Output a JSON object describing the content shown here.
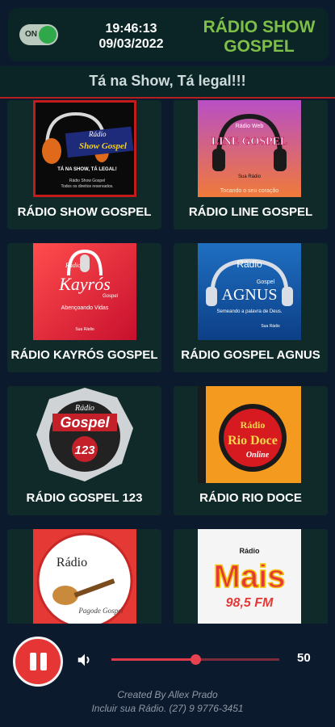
{
  "header": {
    "toggle_label": "ON",
    "time": "19:46:13",
    "date": "09/03/2022",
    "title_line1": "RÁDIO SHOW",
    "title_line2": "GOSPEL"
  },
  "slogan": "Tá na Show, Tá legal!!!",
  "stations": [
    {
      "name": "RÁDIO SHOW GOSPEL",
      "logo_text": [
        "Rádio",
        "Show Gospel",
        "TÁ NA SHOW, TÁ LEGAL!",
        "Rádio Show Gospel",
        "Todos os direitos reservados."
      ]
    },
    {
      "name": "RÁDIO LINE GOSPEL",
      "logo_text": [
        "Rádio Web",
        "LINE GOSPEL",
        "Sua Rádio",
        "Tocando o seu coração"
      ]
    },
    {
      "name": "RÁDIO KAYRÓS GOSPEL",
      "logo_text": [
        "Rádio",
        "Kayrós",
        "Gospel",
        "Abençoando Vidas",
        "Sua Rádio"
      ]
    },
    {
      "name": "RÁDIO GOSPEL AGNUS",
      "logo_text": [
        "Rádio",
        "Gospel",
        "AGNUS",
        "Semeando a palavra de Deus.",
        "Sua Rádio"
      ]
    },
    {
      "name": "RÁDIO GOSPEL 123",
      "logo_text": [
        "Rádio",
        "Gospel",
        "123"
      ]
    },
    {
      "name": "RÁDIO RIO DOCE",
      "logo_text": [
        "Rádio",
        "Rio Doce",
        "Online"
      ]
    },
    {
      "name": "",
      "logo_text": [
        "Rádio",
        "Pagode Gospel"
      ]
    },
    {
      "name": "",
      "logo_text": [
        "Rádio",
        "Mais",
        "98,5 FM"
      ]
    }
  ],
  "player": {
    "volume": 50,
    "volume_label": "50"
  },
  "credits": {
    "line1": "Created By Allex Prado",
    "line2": "Incluir sua Rádio. (27) 9 9776-3451"
  },
  "colors": {
    "background": "#0c1a2e",
    "panel": "#0b2526",
    "card": "#102a2a",
    "title_green": "#7ec047",
    "accent_red": "#e53535"
  }
}
